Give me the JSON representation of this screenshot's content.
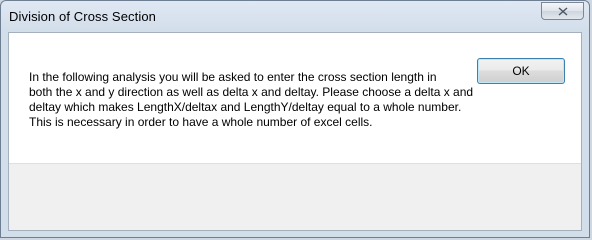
{
  "window": {
    "title": "Division of Cross Section"
  },
  "message": {
    "lines": [
      "In the following analysis you will be asked to enter the cross section length in",
      "both the x and y direction as well as delta x and deltay. Please choose a delta x and",
      "deltay which makes LengthX/deltax and LengthY/deltay equal to a whole number.",
      "This is necessary in order to have a whole number of excel cells."
    ]
  },
  "buttons": {
    "ok_label": "OK",
    "close_icon": "close-icon"
  },
  "colors": {
    "title_bar": "#dfe8f3",
    "message_background": "#ffffff",
    "button_area_background": "#f0f0f0",
    "ok_button_border": "#3c7fb1"
  }
}
